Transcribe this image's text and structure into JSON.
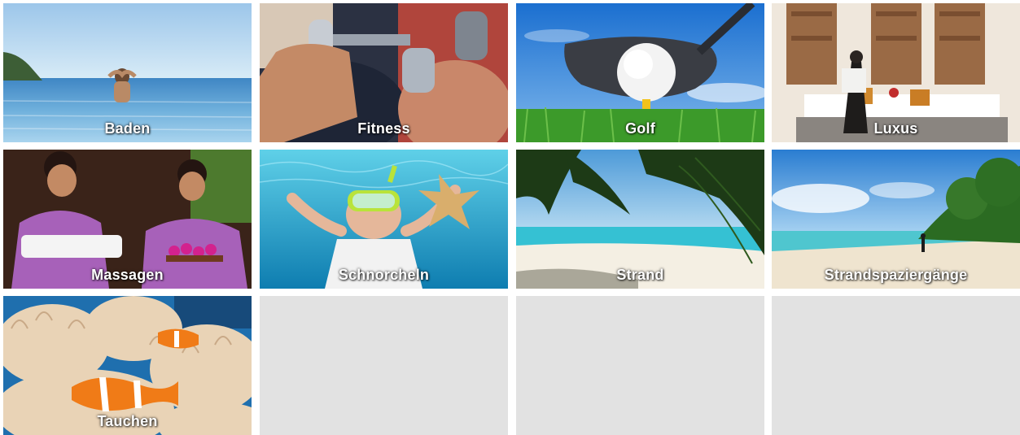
{
  "tiles": [
    {
      "label": "Baden"
    },
    {
      "label": "Fitness"
    },
    {
      "label": "Golf"
    },
    {
      "label": "Luxus"
    },
    {
      "label": "Massagen"
    },
    {
      "label": "Schnorcheln"
    },
    {
      "label": "Strand"
    },
    {
      "label": "Strandspaziergänge"
    },
    {
      "label": "Tauchen"
    }
  ],
  "colors": {
    "placeholder": "#e2e2e2",
    "label_text": "#ffffff"
  }
}
